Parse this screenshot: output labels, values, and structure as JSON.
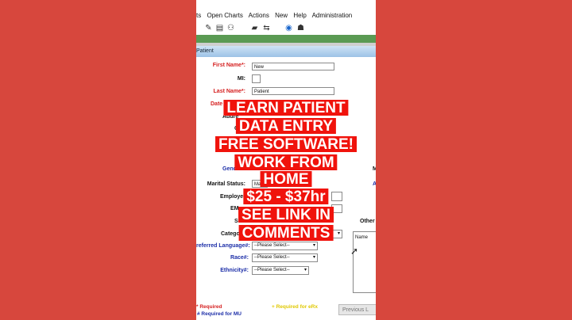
{
  "menu": [
    "ts",
    "Open Charts",
    "Actions",
    "New",
    "Help",
    "Administration"
  ],
  "toolbar_icons": [
    "edit-icon",
    "open-chart-icon",
    "group-icon",
    "folder-icon",
    "arrows-icon",
    "help-icon",
    "road-icon"
  ],
  "window_title": "Patient",
  "form": {
    "first_name_label": "First Name*:",
    "first_name_value": "New",
    "mi_label": "MI:",
    "last_name_label": "Last Name*:",
    "last_name_value": "Patient",
    "dob_label": "Date o",
    "address_label": "Addre",
    "city_label": "C",
    "gender_label": "Gende",
    "marital_label": "Marital Status:",
    "marital_value": "Ma",
    "employer_label": "Employe",
    "email_label": "EMa",
    "ssn_label": "SS",
    "category_label": "Catego",
    "language_label": "referred Language#:",
    "language_value": "--Please Select--",
    "race_label": "Race#:",
    "race_value": "--Please Select--",
    "ethnicity_label": "Ethnicity#:",
    "ethnicity_value": "--Please Select--",
    "right_m1": "M",
    "right_m2": "A",
    "other_label": "Other",
    "name_col": "Name"
  },
  "footer": {
    "required": "* Required",
    "required_mu": "# Required for MU",
    "required_erx": "+ Required for eRx",
    "prev_button": "Previous L"
  },
  "overlay_lines": [
    "LEARN PATIENT",
    "DATA ENTRY",
    "FREE SOFTWARE!",
    "WORK FROM",
    "HOME",
    "$25 - $37hr",
    "SEE LINK IN",
    "COMMENTS"
  ],
  "colors": {
    "background": "#d7473d",
    "overlay_red": "#f0130c",
    "required_red": "#d52020",
    "mu_blue": "#1c2ea8",
    "erx_yellow": "#e0c800",
    "header_green": "#5a9a53"
  }
}
